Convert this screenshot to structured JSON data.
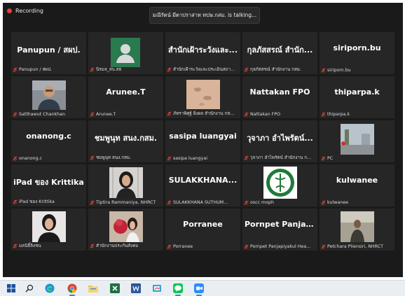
{
  "recording": {
    "label": "Recording"
  },
  "talking": {
    "text": "มณีรัตน์ มีตาปราสาท ทปษ.กสม. is talking..."
  },
  "tiles": [
    {
      "title": "Panupun / สผป.",
      "label": "Panupun / สผป."
    },
    {
      "title": "",
      "label": "นิรมล_สบ.สธ"
    },
    {
      "title": "สำนักเฝ้าระวังและ...",
      "label": "สำนักเฝ้าระวังและประเมินสถา..."
    },
    {
      "title": "กุลภัสสรณ์ สำนัก...",
      "label": "กุลภัสสรณ์ สำนักงาน กสม."
    },
    {
      "title": "siriporn.bu",
      "label": "siriporn.bu"
    },
    {
      "title": "",
      "label": "Satthawut Chankhan"
    },
    {
      "title": "Arunee.T",
      "label": "Arunee.T"
    },
    {
      "title": "",
      "label": "ภัทราพิศุฐ์ ยิ่งผล สำนักงาน กส..."
    },
    {
      "title": "Nattakan FPO",
      "label": "Nattakan FPO"
    },
    {
      "title": "thiparpa.k",
      "label": "thiparpa.k"
    },
    {
      "title": "onanong.c",
      "label": "onanong.c"
    },
    {
      "title": "ชมพูนุท สนง.กสม.",
      "label": "ชมพูนุท สนง.กสม."
    },
    {
      "title": "sasipa luangyai",
      "label": "sasipa luangyai"
    },
    {
      "title": "วุจาภา อำไพรัตน์...",
      "label": "วุจาภา อำไพรัตน์ สำนักงาน ก..."
    },
    {
      "title": "",
      "label": "PC"
    },
    {
      "title": "iPad ของ Krittika",
      "label": "iPad ของ Krittika"
    },
    {
      "title": "",
      "label": "Tiptira Rammaniya, NHRCT"
    },
    {
      "title": "SULAKKHANA...",
      "label": "SULAKKHANA SUTHUM..."
    },
    {
      "title": "",
      "label": "oscc moph"
    },
    {
      "title": "kulwanee",
      "label": "kulwanee"
    },
    {
      "title": "",
      "label": "มลนิธิ์ลิงชน"
    },
    {
      "title": "",
      "label": "สำนักงานประกันสังคม"
    },
    {
      "title": "Porranee",
      "label": "Porranee"
    },
    {
      "title": "Pornpet Panjapi...",
      "label": "Pornpet Panjapiyakul Hea..."
    },
    {
      "title": "",
      "label": "Petchara Pliensiri, NHRCT"
    }
  ],
  "taskbar": {
    "items": [
      "windows-start",
      "search",
      "edge",
      "chrome",
      "file-explorer",
      "excel",
      "word",
      "paint",
      "line",
      "zoom"
    ]
  },
  "colors": {
    "mic_muted": "#e0413a",
    "screen_bg": "#1a1a1a",
    "tile_bg": "#262626"
  }
}
